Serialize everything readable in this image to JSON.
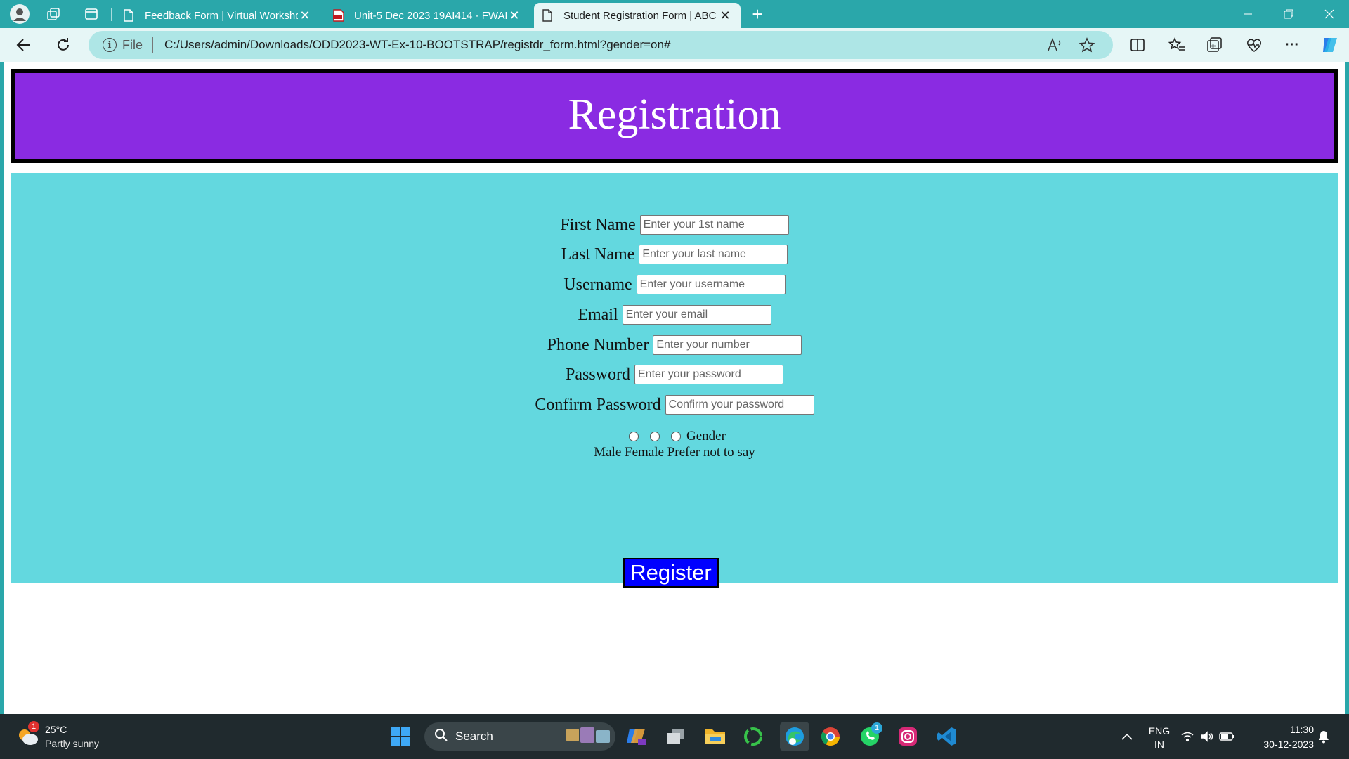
{
  "browser": {
    "tabs": [
      {
        "title": "Feedback Form | Virtual Worksho",
        "icon": "page-icon",
        "active": false
      },
      {
        "title": "Unit-5 Dec 2023 19AI414 - FWAD",
        "icon": "pdf-icon",
        "active": false
      },
      {
        "title": "Student Registration Form | ABC",
        "icon": "page-icon",
        "active": true
      }
    ],
    "new_tab_glyph": "+",
    "close_glyph": "✕",
    "address": {
      "scheme_label": "File",
      "url": "C:/Users/admin/Downloads/ODD2023-WT-Ex-10-BOOTSTRAP/registdr_form.html?gender=on#"
    },
    "colors": {
      "frame": "#2aa7aa",
      "toolbar": "#e6f6f6",
      "omnibox": "#aee6e6"
    }
  },
  "page": {
    "banner_title": "Registration",
    "banner_color": "#8a2be2",
    "panel_color": "#63d8df",
    "fields": [
      {
        "label": "First Name",
        "placeholder": "Enter your 1st name"
      },
      {
        "label": "Last Name",
        "placeholder": "Enter your last name"
      },
      {
        "label": "Username",
        "placeholder": "Enter your username"
      },
      {
        "label": "Email",
        "placeholder": "Enter your email"
      },
      {
        "label": "Phone Number",
        "placeholder": "Enter your number"
      },
      {
        "label": "Password",
        "placeholder": "Enter your password"
      },
      {
        "label": "Confirm Password",
        "placeholder": "Confirm your password"
      }
    ],
    "gender_label": "Gender",
    "gender_options_text": "Male Female Prefer not to say",
    "register_label": "Register",
    "register_color": "#0000ff"
  },
  "taskbar": {
    "weather": {
      "temp": "25°C",
      "desc": "Partly sunny",
      "badge": "1"
    },
    "search_label": "Search",
    "apps": [
      "windows-start",
      "search",
      "copilot",
      "task-view",
      "file-explorer",
      "green-circle-app",
      "edge",
      "chrome",
      "whatsapp",
      "instagram",
      "vscode"
    ],
    "whatsapp_badge": "1",
    "language": {
      "line1": "ENG",
      "line2": "IN"
    },
    "clock": {
      "time": "11:30",
      "date": "30-12-2023"
    }
  }
}
